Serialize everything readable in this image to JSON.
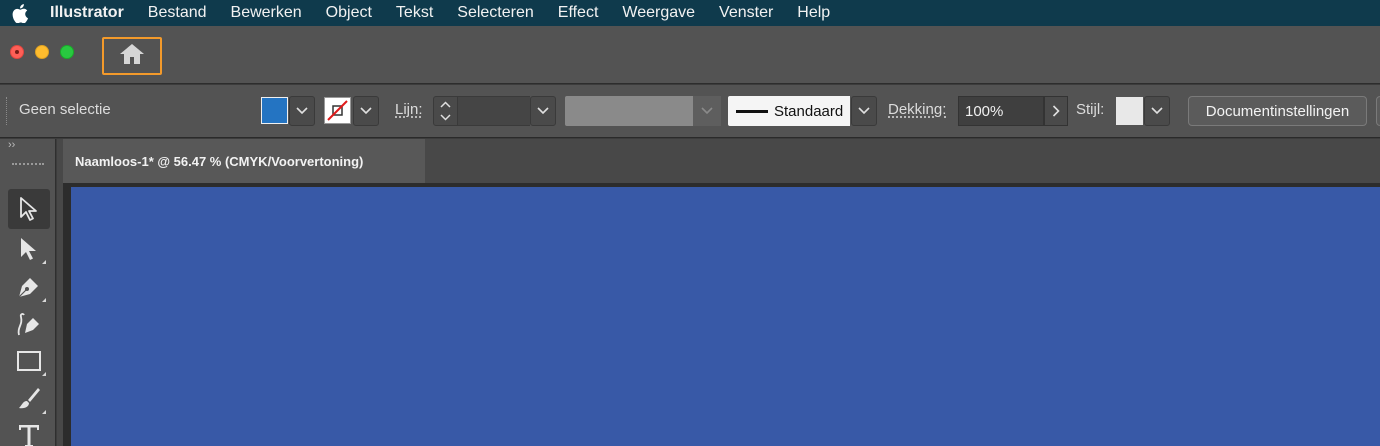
{
  "menubar": {
    "app_name": "Illustrator",
    "items": [
      "Bestand",
      "Bewerken",
      "Object",
      "Tekst",
      "Selecteren",
      "Effect",
      "Weergave",
      "Venster",
      "Help"
    ]
  },
  "titlebar": {
    "home_icon": "home-icon"
  },
  "controlbar": {
    "selection_status": "Geen selectie",
    "fill_color": "#2474c2",
    "stroke_color": "none",
    "stroke_label": "Lijn:",
    "stroke_weight": "",
    "brush_name": "Standaard",
    "opacity_label": "Dekking:",
    "opacity_value": "100%",
    "style_label": "Stijl:",
    "document_settings_label": "Documentinstellingen"
  },
  "document": {
    "tab_title": "Naamloos-1* @ 56.47 % (CMYK/Voorvertoning)",
    "artboard_color": "#3859a7"
  },
  "tools": {
    "collapse_glyph": "››",
    "items": [
      "selection-tool",
      "direct-selection-tool",
      "pen-tool",
      "curvature-tool",
      "rectangle-tool",
      "paintbrush-tool",
      "type-tool"
    ]
  }
}
